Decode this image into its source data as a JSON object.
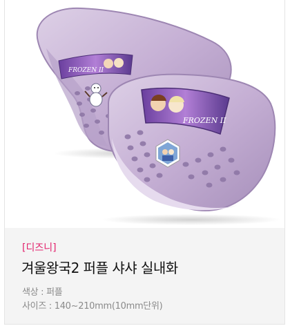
{
  "product": {
    "image_alt": "겨울왕국2 퍼플 샤샤 실내화 product photo",
    "shoe_badge_text": "FROZEN II",
    "brand": "[디즈니]",
    "name": "겨울왕국2 퍼플 샤샤 실내화",
    "color_line": "색상 : 퍼플",
    "size_line": "사이즈 : 140~210mm(10mm단위)"
  },
  "colors": {
    "shoe": "#c9b4d6",
    "shoe_dark": "#a892bb",
    "shoe_light": "#e3d6ea",
    "brand_text": "#e2216b",
    "info_bg": "#f4f4f4"
  }
}
